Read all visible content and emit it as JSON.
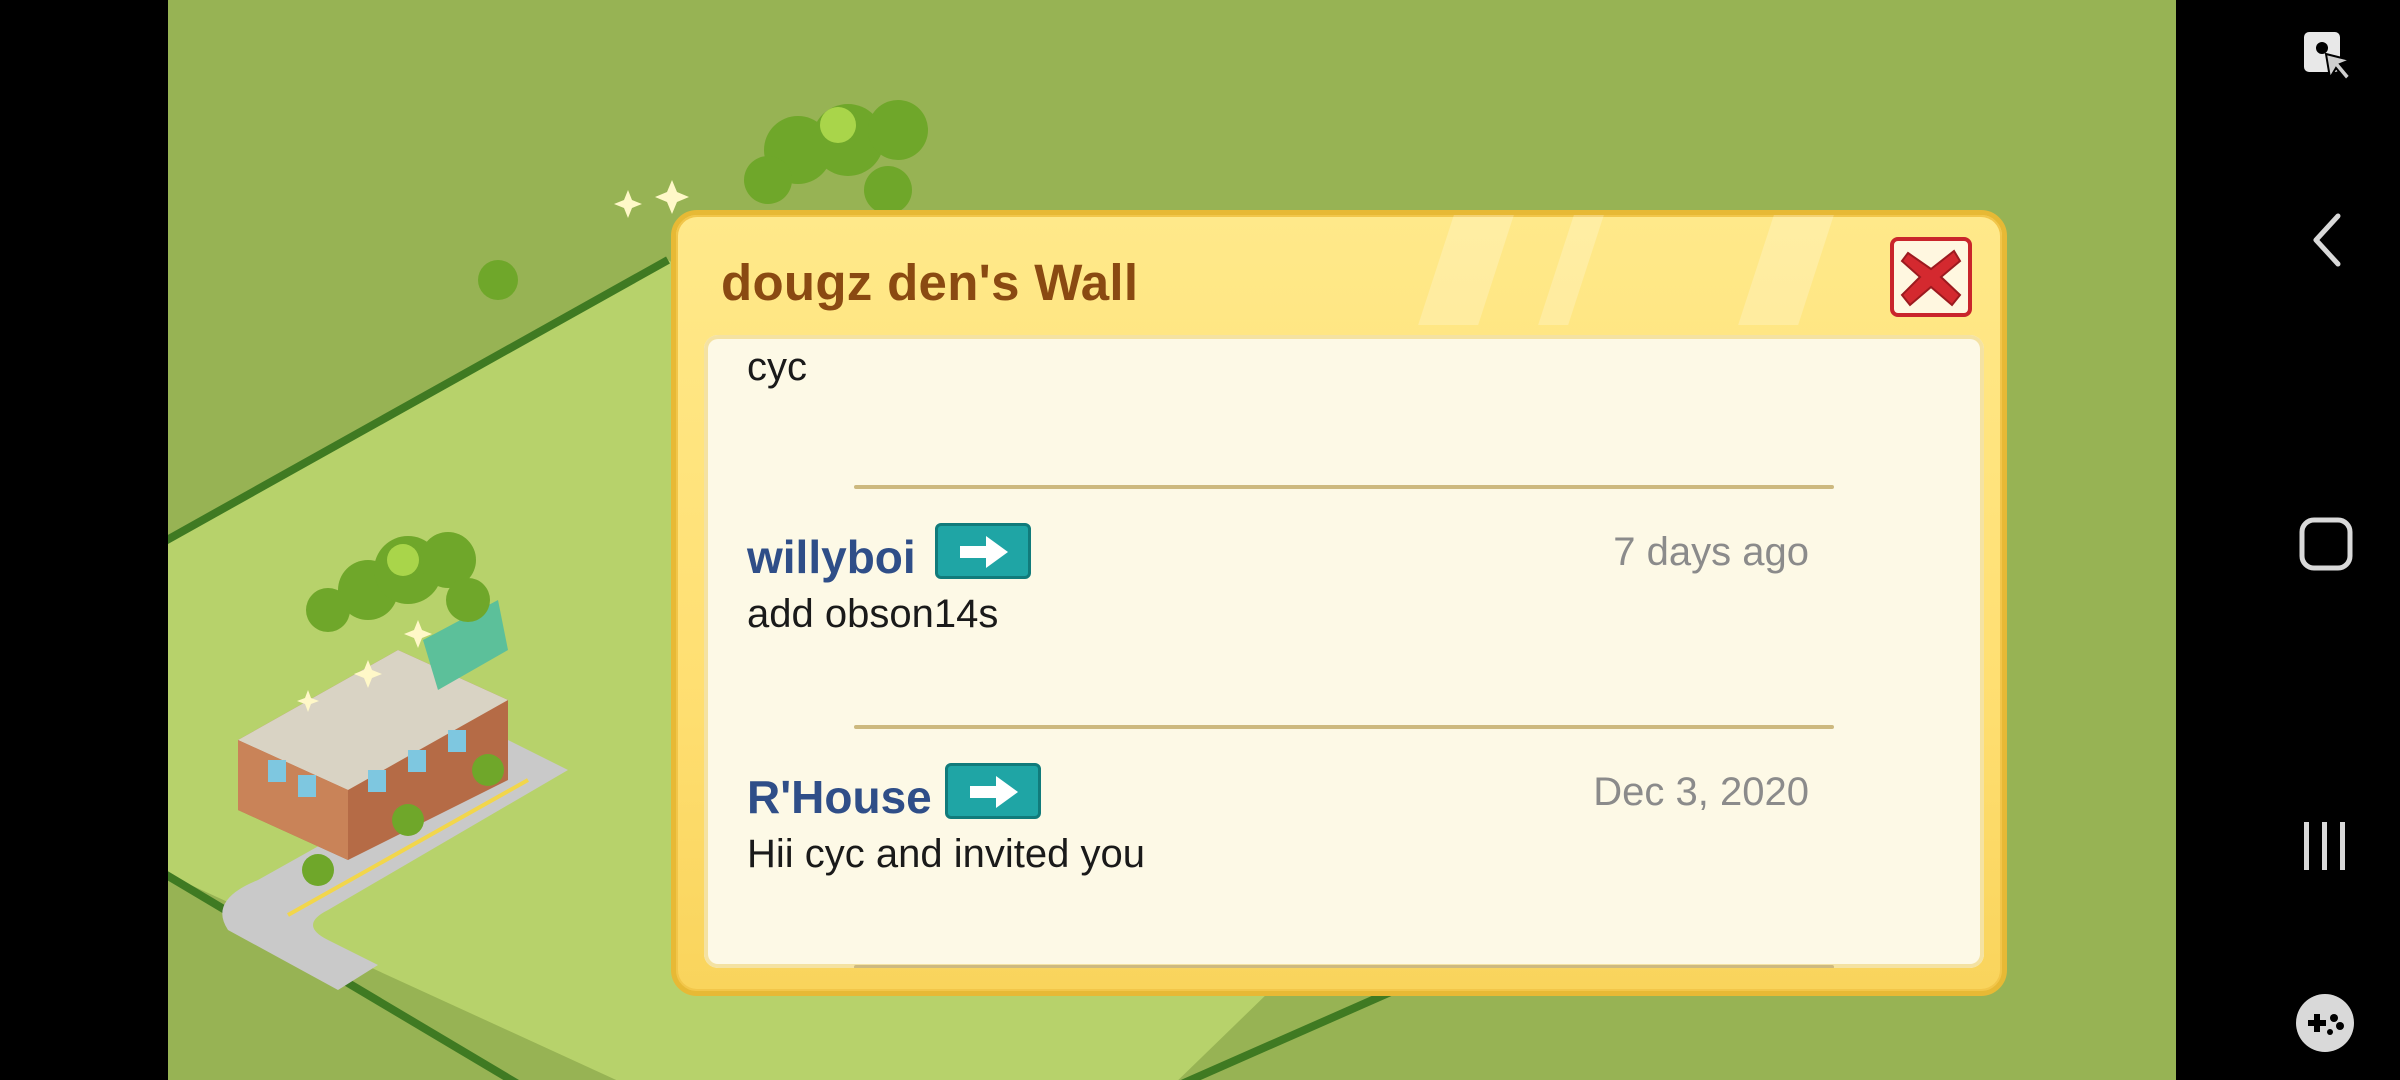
{
  "dialog": {
    "title": "dougz den's Wall",
    "close_icon": "close-x-icon"
  },
  "posts": [
    {
      "author": "",
      "time": "",
      "text": "cyc"
    },
    {
      "author": "willyboi",
      "time": "7 days ago",
      "text": "add obson14s",
      "go_icon": "arrow-right-icon"
    },
    {
      "author": "R'House",
      "time": "Dec 3, 2020",
      "text": "Hii cyc and invited you",
      "go_icon": "arrow-right-icon"
    }
  ],
  "system_nav": {
    "top_icon": "touch-lock-icon",
    "back_icon": "back-icon",
    "home_icon": "home-icon",
    "recents_icon": "recent-apps-icon",
    "game_icon": "game-tools-icon"
  },
  "colors": {
    "grass": "#97b354",
    "dialog_frame": "#ffdf72",
    "author": "#2f4e88",
    "go_button": "#1fa5a5",
    "close": "#c9252b"
  }
}
